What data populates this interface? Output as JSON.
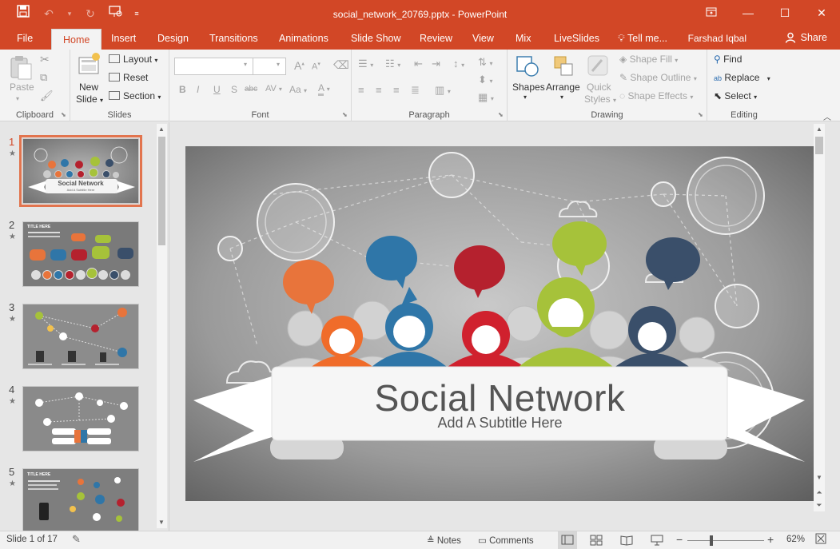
{
  "window": {
    "title": "social_network_20769.pptx - PowerPoint",
    "controls": [
      "restore-ribbon",
      "minimize",
      "maximize",
      "close"
    ]
  },
  "tabs": [
    {
      "label": "File"
    },
    {
      "label": "Home"
    },
    {
      "label": "Insert"
    },
    {
      "label": "Design"
    },
    {
      "label": "Transitions"
    },
    {
      "label": "Animations"
    },
    {
      "label": "Slide Show"
    },
    {
      "label": "Review"
    },
    {
      "label": "View"
    },
    {
      "label": "Mix"
    },
    {
      "label": "LiveSlides"
    },
    {
      "label": "Tell me..."
    }
  ],
  "active_tab": "Home",
  "user": {
    "name": "Farshad Iqbal",
    "share_label": "Share"
  },
  "ribbon": {
    "clipboard": {
      "label": "Clipboard",
      "paste": "Paste"
    },
    "slides": {
      "label": "Slides",
      "new_slide_line1": "New",
      "new_slide_line2": "Slide",
      "layout": "Layout",
      "reset": "Reset",
      "section": "Section"
    },
    "font": {
      "label": "Font",
      "bold": "B",
      "italic": "I",
      "underline": "U",
      "shadow": "S",
      "strike": "abc",
      "spacing": "AV",
      "case": "Aa",
      "grow": "A",
      "shrink": "A"
    },
    "paragraph": {
      "label": "Paragraph"
    },
    "drawing": {
      "label": "Drawing",
      "shapes": "Shapes",
      "arrange": "Arrange",
      "quick_styles_1": "Quick",
      "quick_styles_2": "Styles",
      "shape_fill": "Shape Fill",
      "shape_outline": "Shape Outline",
      "shape_effects": "Shape Effects"
    },
    "editing": {
      "label": "Editing",
      "find": "Find",
      "replace": "Replace",
      "select": "Select"
    }
  },
  "thumbnails": [
    {
      "number": "1",
      "active": true,
      "title": "Social Network",
      "subtitle": "Add A Subtitle Here"
    },
    {
      "number": "2",
      "active": false,
      "title": "TITLE HERE"
    },
    {
      "number": "3",
      "active": false
    },
    {
      "number": "4",
      "active": false
    },
    {
      "number": "5",
      "active": false,
      "title": "TITLE HERE"
    }
  ],
  "slide": {
    "title": "Social Network",
    "subtitle": "Add A Subtitle Here"
  },
  "status": {
    "slide_counter": "Slide 1 of 17",
    "notes": "Notes",
    "comments": "Comments",
    "zoom": "62%",
    "zoom_fraction": 0.62
  },
  "colors": {
    "accent": "#d24726",
    "bubble_orange": "#e8743b",
    "bubble_blue": "#2f76a8",
    "bubble_red": "#b5212e",
    "bubble_green": "#a6c23a",
    "bubble_navy": "#3a4f6a"
  }
}
